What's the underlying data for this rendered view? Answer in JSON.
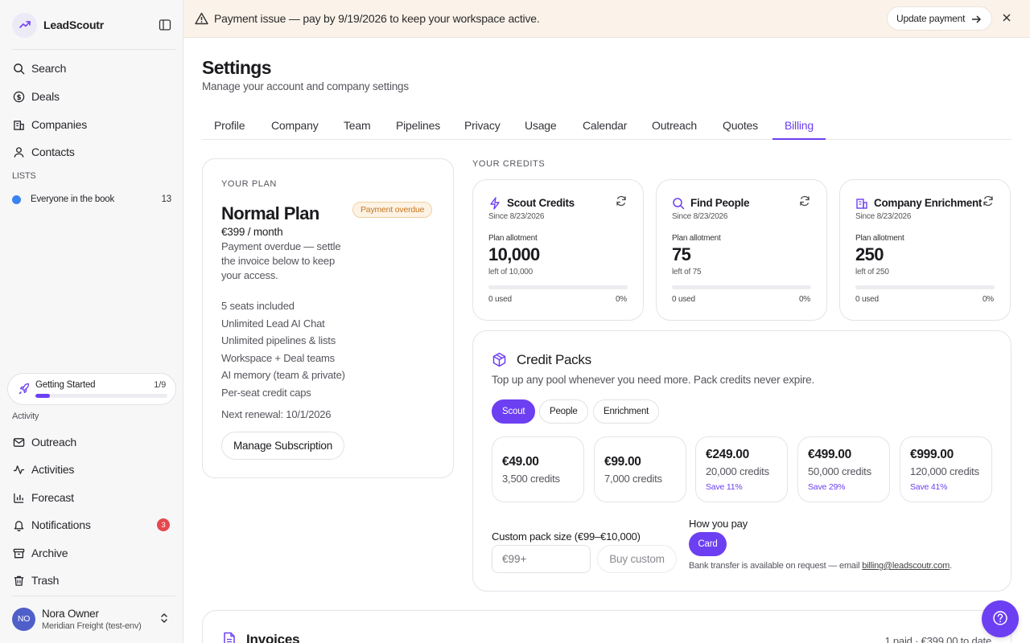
{
  "app": {
    "name": "LeadScoutr"
  },
  "sidebar": {
    "nav": [
      {
        "label": "Search",
        "icon": "search-icon"
      },
      {
        "label": "Deals",
        "icon": "dollar-icon"
      },
      {
        "label": "Companies",
        "icon": "building-icon"
      },
      {
        "label": "Contacts",
        "icon": "user-icon"
      }
    ],
    "lists_label": "LISTS",
    "lists": [
      {
        "label": "Everyone in the book",
        "count": "13",
        "color": "#3c82f0"
      }
    ],
    "getting_started": {
      "label": "Getting Started",
      "count": "1/9",
      "progress": 0.11
    },
    "activity_label": "Activity",
    "activity": [
      {
        "label": "Outreach",
        "icon": "mail-icon"
      },
      {
        "label": "Activities",
        "icon": "activity-icon"
      },
      {
        "label": "Forecast",
        "icon": "bar-chart-icon"
      },
      {
        "label": "Notifications",
        "icon": "bell-icon",
        "badge": "3"
      },
      {
        "label": "Archive",
        "icon": "archive-icon"
      },
      {
        "label": "Trash",
        "icon": "trash-icon"
      }
    ],
    "user": {
      "initials": "NO",
      "name": "Nora Owner",
      "org": "Meridian Freight (test-env)"
    }
  },
  "banner": {
    "text": "Payment issue — pay by 9/19/2026 to keep your workspace active.",
    "button": "Update payment"
  },
  "header": {
    "title": "Settings",
    "subtitle": "Manage your account and company settings"
  },
  "tabs": [
    {
      "label": "Profile"
    },
    {
      "label": "Company"
    },
    {
      "label": "Team"
    },
    {
      "label": "Pipelines"
    },
    {
      "label": "Privacy"
    },
    {
      "label": "Usage"
    },
    {
      "label": "Calendar"
    },
    {
      "label": "Outreach"
    },
    {
      "label": "Quotes"
    },
    {
      "label": "Billing",
      "active": true
    }
  ],
  "plan": {
    "eyebrow": "YOUR PLAN",
    "name": "Normal Plan",
    "status": "Payment overdue",
    "price": "€399 / month",
    "description": "Payment overdue — settle the invoice below to keep your access.",
    "features": [
      "5 seats included",
      "Unlimited Lead AI Chat",
      "Unlimited pipelines & lists",
      "Workspace + Deal teams",
      "AI memory (team & private)",
      "Per-seat credit caps"
    ],
    "renewal": "Next renewal: 10/1/2026",
    "manage_button": "Manage Subscription"
  },
  "credits": {
    "label": "YOUR CREDITS",
    "cards": [
      {
        "title": "Scout Credits",
        "icon": "bolt-icon",
        "since": "Since 8/23/2026",
        "allotment_label": "Plan allotment",
        "value": "10,000",
        "left": "left of 10,000",
        "used": "0 used",
        "percent": "0%",
        "fraction_used": 0
      },
      {
        "title": "Find People",
        "icon": "search-icon",
        "since": "Since 8/23/2026",
        "allotment_label": "Plan allotment",
        "value": "75",
        "left": "left of 75",
        "used": "0 used",
        "percent": "0%",
        "fraction_used": 0
      },
      {
        "title": "Company Enrichment",
        "icon": "building-icon",
        "since": "Since 8/23/2026",
        "allotment_label": "Plan allotment",
        "value": "250",
        "left": "left of 250",
        "used": "0 used",
        "percent": "0%",
        "fraction_used": 0
      }
    ]
  },
  "packs": {
    "title": "Credit Packs",
    "subtitle": "Top up any pool whenever you need more. Pack credits never expire.",
    "tabs": [
      {
        "label": "Scout",
        "active": true
      },
      {
        "label": "People"
      },
      {
        "label": "Enrichment"
      }
    ],
    "items": [
      {
        "price": "€49.00",
        "credits": "3,500 credits",
        "save": ""
      },
      {
        "price": "€99.00",
        "credits": "7,000 credits",
        "save": ""
      },
      {
        "price": "€249.00",
        "credits": "20,000 credits",
        "save": "Save 11%"
      },
      {
        "price": "€499.00",
        "credits": "50,000 credits",
        "save": "Save 29%"
      },
      {
        "price": "€999.00",
        "credits": "120,000 credits",
        "save": "Save 41%"
      }
    ],
    "custom_label": "Custom pack size (€99–€10,000)",
    "custom_placeholder": "€99+",
    "buy_custom": "Buy custom",
    "how_you_pay": "How you pay",
    "card_button": "Card",
    "bank_note_prefix": "Bank transfer is available on request — email ",
    "bank_email": "billing@leadscoutr.com",
    "bank_note_suffix": "."
  },
  "invoices": {
    "title": "Invoices",
    "summary": "1 paid · €399.00 to date"
  },
  "colors": {
    "accent": "#6d3ff2",
    "warning": "#c7751b",
    "danger": "#e5484d"
  }
}
